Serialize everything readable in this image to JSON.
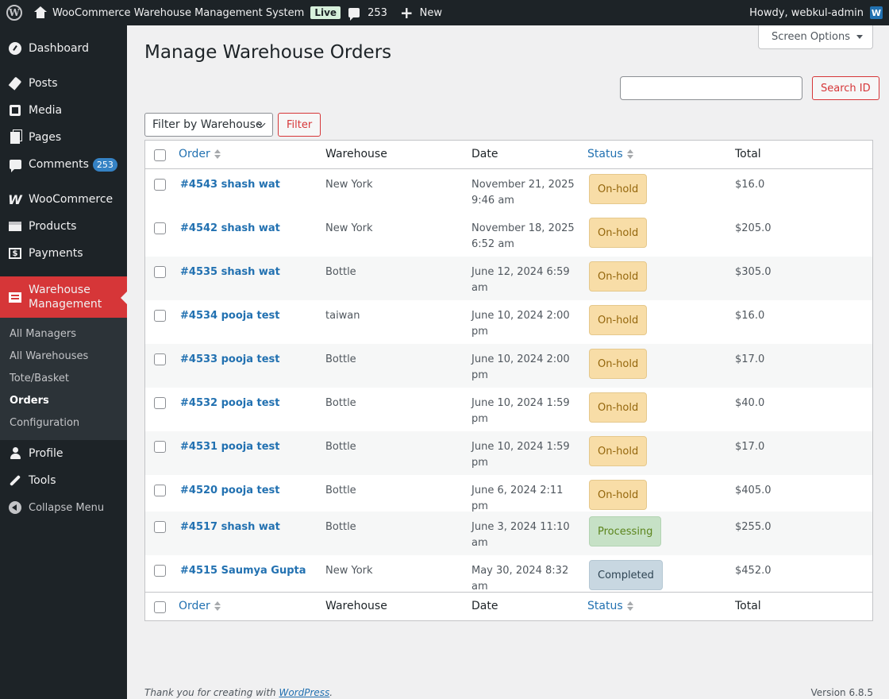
{
  "adminbar": {
    "site_name": "WooCommerce Warehouse Management System",
    "live_badge": "Live",
    "comments_count": "253",
    "new_label": "New",
    "howdy": "Howdy, webkul-admin",
    "avatar_letter": "W"
  },
  "sidebar": {
    "dashboard": "Dashboard",
    "posts": "Posts",
    "media": "Media",
    "pages": "Pages",
    "comments": "Comments",
    "comments_count": "253",
    "woocommerce": "WooCommerce",
    "products": "Products",
    "payments": "Payments",
    "warehouse_line1": "Warehouse",
    "warehouse_line2": "Management",
    "submenu": [
      "All Managers",
      "All Warehouses",
      "Tote/Basket",
      "Orders",
      "Configuration"
    ],
    "profile": "Profile",
    "tools": "Tools",
    "collapse": "Collapse Menu"
  },
  "main": {
    "screen_options": "Screen Options",
    "title": "Manage Warehouse Orders",
    "search_placeholder": "",
    "search_button": "Search ID",
    "filter_select": "Filter by Warehouse",
    "filter_button": "Filter"
  },
  "table": {
    "headers": {
      "order": "Order",
      "warehouse": "Warehouse",
      "date": "Date",
      "status": "Status",
      "total": "Total"
    },
    "rows": [
      {
        "order": "#4543 shash wat",
        "warehouse": "New York",
        "date": "November 21, 2025 9:46 am",
        "status": "On-hold",
        "total": "$16.0"
      },
      {
        "order": "#4542 shash wat",
        "warehouse": "New York",
        "date": "November 18, 2025 6:52 am",
        "status": "On-hold",
        "total": "$205.0"
      },
      {
        "order": "#4535 shash wat",
        "warehouse": "Bottle",
        "date": "June 12, 2024 6:59 am",
        "status": "On-hold",
        "total": "$305.0"
      },
      {
        "order": "#4534 pooja test",
        "warehouse": "taiwan",
        "date": "June 10, 2024 2:00 pm",
        "status": "On-hold",
        "total": "$16.0"
      },
      {
        "order": "#4533 pooja test",
        "warehouse": "Bottle",
        "date": "June 10, 2024 2:00 pm",
        "status": "On-hold",
        "total": "$17.0"
      },
      {
        "order": "#4532 pooja test",
        "warehouse": "Bottle",
        "date": "June 10, 2024 1:59 pm",
        "status": "On-hold",
        "total": "$40.0"
      },
      {
        "order": "#4531 pooja test",
        "warehouse": "Bottle",
        "date": "June 10, 2024 1:59 pm",
        "status": "On-hold",
        "total": "$17.0"
      },
      {
        "order": "#4520 pooja test",
        "warehouse": "Bottle",
        "date": "June 6, 2024 2:11 pm",
        "status": "On-hold",
        "total": "$405.0"
      },
      {
        "order": "#4517 shash wat",
        "warehouse": "Bottle",
        "date": "June 3, 2024 11:10 am",
        "status": "Processing",
        "total": "$255.0"
      },
      {
        "order": "#4515 Saumya Gupta",
        "warehouse": "New York",
        "date": "May 30, 2024 8:32 am",
        "status": "Completed",
        "total": "$452.0"
      }
    ]
  },
  "footer": {
    "thanks_prefix": "Thank you for creating with ",
    "wp_link": "WordPress",
    "thanks_suffix": ".",
    "version": "Version 6.8.5"
  },
  "colors": {
    "admin_dark": "#1d2327",
    "accent_red": "#d63638",
    "link_blue": "#2271b1",
    "onhold_bg": "#f8dda7",
    "processing_bg": "#c6e1c6",
    "completed_bg": "#c8d7e1"
  }
}
